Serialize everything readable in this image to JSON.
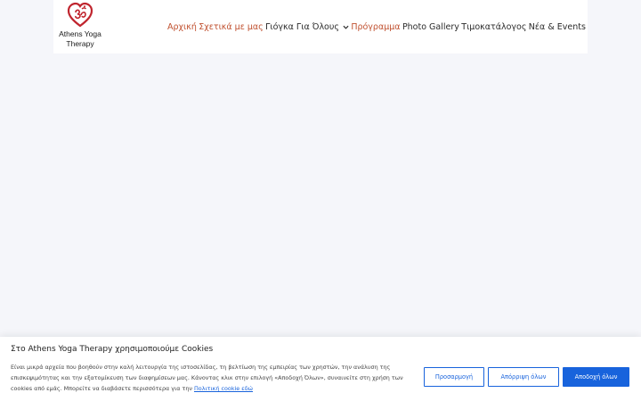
{
  "header": {
    "logo_alt": "Athens Yoga Therapy",
    "logo_line1": "Athens Yoga",
    "logo_line2": "Therapy",
    "logo_icon": "heart-om-icon"
  },
  "nav": {
    "items": [
      {
        "label": "Αρχική",
        "accent": true
      },
      {
        "label": "Σχετικά με μας",
        "accent": true
      },
      {
        "label": "Γιόγκα Για Όλους",
        "accent": false,
        "dropdown": true
      },
      {
        "label": "Πρόγραμμα",
        "accent": true
      },
      {
        "label": "Photo Gallery",
        "accent": false
      },
      {
        "label": "Τιμοκατάλογος",
        "accent": false
      },
      {
        "label": "Νέα & Events",
        "accent": false
      }
    ]
  },
  "cookie": {
    "title": "Στο Athens Yoga Therapy χρησιμοποιούμε Cookies",
    "body": "Είναι μικρά αρχεία που βοηθούν στην καλή λειτουργία της ιστοσελίδας, τη βελτίωση της εμπειρίας των χρηστών, την ανάλυση της επισκεψιμότητας και την εξατομίκευση των διαφημίσεων μας. Κάνοντας κλικ στην επιλογή «Αποδοχή Όλων», συναινείτε στη χρήση των cookies από εμάς. Μπορείτε να διαβάσετε περισσότερα για την ",
    "link": "Πολιτική cookie εδώ",
    "customize_label": "Προσαρμογή",
    "reject_label": "Απόρριψη όλων",
    "accept_label": "Αποδοχή όλων"
  },
  "colors": {
    "accent": "#c0502f",
    "primary_button": "#1863dc",
    "logo": "#c0252e"
  }
}
